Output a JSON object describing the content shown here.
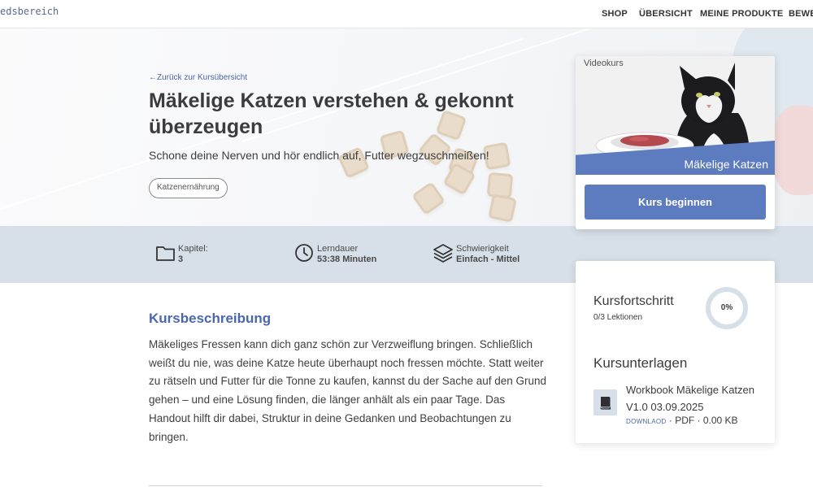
{
  "header": {
    "brand": "edsbereich",
    "nav": [
      "SHOP",
      "ÜBERSICHT",
      "MEINE PRODUKTE",
      "BEWE"
    ]
  },
  "hero": {
    "back_link": "Zurück zur Kursübersicht",
    "title": "Mäkelige Katzen verstehen & gekonnt überzeugen",
    "subtitle": "Schone deine Nerven und hör endlich auf, Futter wegzuschmeißen!",
    "tag": "Katzenernährung"
  },
  "stats": [
    {
      "label": "Kapitel:",
      "value": "3",
      "icon": "folder-icon"
    },
    {
      "label": "Lerndauer",
      "value": "53:38 Minuten",
      "icon": "clock-icon"
    },
    {
      "label": "Schwierigkeit",
      "value": "Einfach - Mittel",
      "icon": "layers-icon"
    }
  ],
  "description": {
    "heading": "Kursbeschreibung",
    "body": "Mäkeliges Fressen kann dich ganz schön zur Verzweiflung bringen. Schließlich weißt du nie, was deine Katze heute überhaupt noch fressen möchte. Statt weiter zu rätseln und Futter für die Tonne zu kaufen, kannst du der Sache auf den Grund gehen – und eine Lösung finden, die länger anhält als ein paar Tage. Das Handout hilft dir dabei, Struktur in deine Gedanken und Beobachtungen zu bringen."
  },
  "course_card": {
    "kind": "Videokurs",
    "banner": "Mäkelige Katzen",
    "button": "Kurs beginnen"
  },
  "progress": {
    "title": "Kursfortschritt",
    "lessons": "0/3 Lektionen",
    "percent": "0%",
    "percent_value": 0
  },
  "materials": {
    "title": "Kursunterlagen",
    "files": [
      {
        "name": "Workbook Mäkelige Katzen V1.0 03.09.2025",
        "download": "DOWNLAOD",
        "meta": "· PDF · 0.00 KB",
        "icon": "book-icon"
      }
    ]
  },
  "colors": {
    "accent": "#5d7cbf",
    "link": "#4a66b0",
    "stats_bg": "#d7dfe8"
  }
}
